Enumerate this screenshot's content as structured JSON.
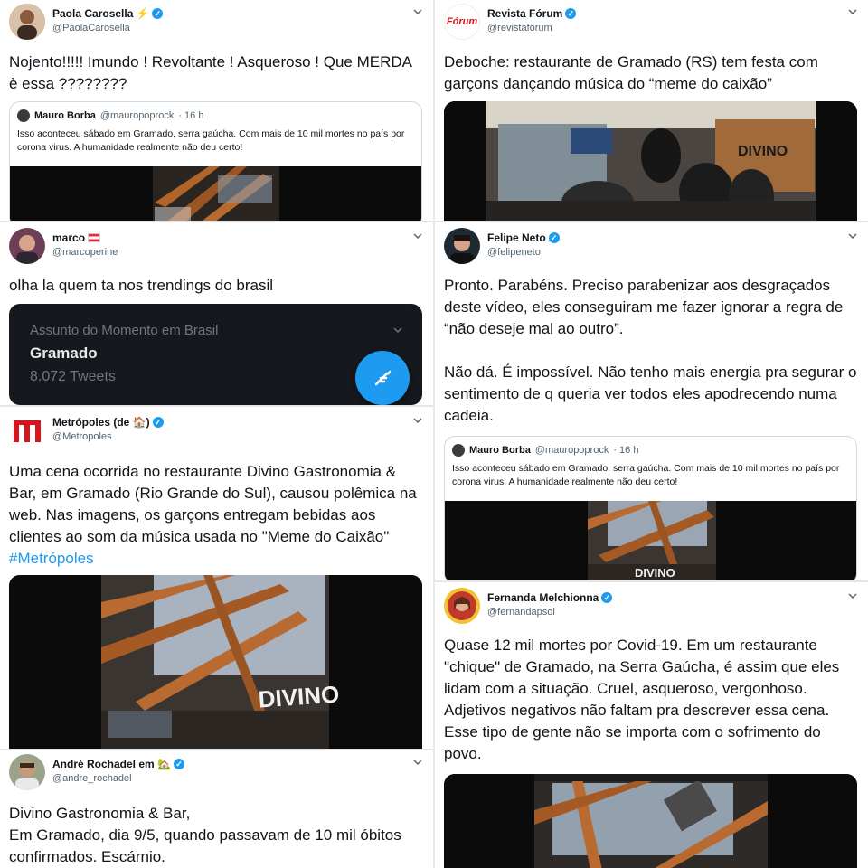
{
  "tweets": {
    "paola": {
      "name": "Paola Carosella",
      "name_extra": "⚡",
      "handle": "@PaolaCarosella",
      "text": "Nojento!!!!! Imundo ! Revoltante ! Asqueroso ! Que MERDA è essa ????????",
      "quote": {
        "name": "Mauro Borba",
        "handle": "@mauropoprock",
        "time": "· 16 h",
        "text": "Isso aconteceu sábado em Gramado, serra gaúcha. Com mais de 10 mil mortes no país por corona virus. A humanidade realmente não deu certo!"
      }
    },
    "forum": {
      "name": "Revista Fórum",
      "avatar_text": "Fórum",
      "handle": "@revistaforum",
      "text": "Deboche: restaurante de Gramado (RS) tem festa com garçons dançando música do “meme do caixão”",
      "media_sign": "DIVINO"
    },
    "marco": {
      "name": "marco",
      "handle": "@marcoperine",
      "text": "olha la quem ta nos trendings do brasil",
      "trend": {
        "subtitle": "Assunto do Momento em Brasil",
        "title": "Gramado",
        "count": "8.072 Tweets"
      }
    },
    "felipe": {
      "name": "Felipe Neto",
      "handle": "@felipeneto",
      "text": "Pronto. Parabéns. Preciso parabenizar aos desgraçados deste vídeo, eles conseguiram me fazer ignorar a regra de “não deseje mal ao outro”.\n\nNão dá. É impossível. Não tenho mais energia pra segurar o sentimento de q queria ver todos eles apodrecendo numa cadeia.",
      "quote": {
        "name": "Mauro Borba",
        "handle": "@mauropoprock",
        "time": "· 16 h",
        "text": "Isso aconteceu sábado em Gramado, serra gaúcha. Com mais de 10 mil mortes no país por corona virus. A humanidade realmente não deu certo!"
      },
      "media_sign": "DIVINO"
    },
    "metropoles": {
      "name": "Metrópoles (de 🏠)",
      "handle": "@Metropoles",
      "text_main": "Uma cena ocorrida no restaurante Divino Gastronomia & Bar, em Gramado (Rio Grande do Sul), causou polêmica na web. Nas imagens, os garçons entregam bebidas aos clientes ao som da música usada no \"Meme do Caixão\" ",
      "hashtag": "#Metrópoles",
      "media_sign": "DIVINO"
    },
    "fernanda": {
      "name": "Fernanda Melchionna",
      "handle": "@fernandapsol",
      "text": "Quase 12 mil mortes por Covid-19. Em um restaurante \"chique\" de Gramado, na Serra Gaúcha, é assim que eles lidam com a situação. Cruel, asqueroso, vergonhoso. Adjetivos negativos não faltam pra descrever essa cena. Esse tipo de gente não se importa com o sofrimento do povo."
    },
    "andre": {
      "name": "André Rochadel em 🏡",
      "handle": "@andre_rochadel",
      "text": "Divino Gastronomia & Bar,\nEm Gramado, dia 9/5, quando passavam de 10 mil óbitos confirmados. Escárnio."
    }
  },
  "colors": {
    "verified": "#1d9bf0",
    "hashtag": "#1d9bf0",
    "text": "#0f1419",
    "secondary": "#536471",
    "metropoles_red": "#d7141d"
  }
}
